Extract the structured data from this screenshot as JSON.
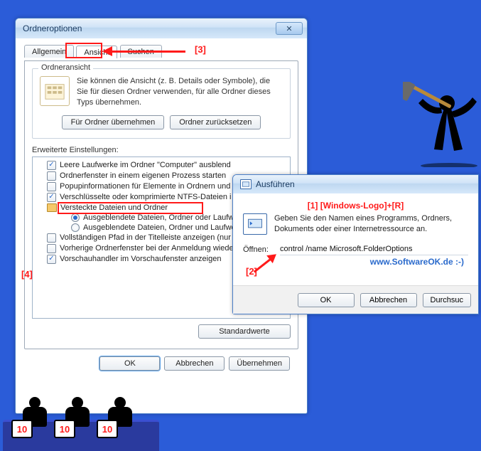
{
  "annotations": {
    "m1": "[1] [Windows-Logo]+[R]",
    "m2": "[2]",
    "m3": "[3]",
    "m4": "[4]"
  },
  "dialog": {
    "title": "Ordneroptionen",
    "tabs": [
      "Allgemein",
      "Ansicht",
      "Suchen"
    ],
    "group": {
      "legend": "Ordneransicht",
      "text": "Sie können die Ansicht (z. B. Details oder Symbole), die Sie für diesen Ordner verwenden, für alle Ordner dieses Typs übernehmen.",
      "btn_apply": "Für Ordner übernehmen",
      "btn_reset": "Ordner zurücksetzen"
    },
    "adv_label": "Erweiterte Einstellungen:",
    "tree": [
      {
        "type": "chk",
        "checked": true,
        "label": "Leere Laufwerke im Ordner \"Computer\" ausblend"
      },
      {
        "type": "chk",
        "checked": false,
        "label": "Ordnerfenster in einem eigenen Prozess starten"
      },
      {
        "type": "chk",
        "checked": false,
        "label": "Popupinformationen für Elemente in Ordnern und "
      },
      {
        "type": "chk",
        "checked": true,
        "label": "Verschlüsselte oder komprimierte NTFS-Dateien i"
      },
      {
        "type": "folder",
        "label": "Versteckte Dateien und Ordner",
        "highlight": true
      },
      {
        "type": "radio",
        "checked": true,
        "nested": true,
        "label": "Ausgeblendete Dateien, Ordner oder Laufwe"
      },
      {
        "type": "radio",
        "checked": false,
        "nested": true,
        "label": "Ausgeblendete Dateien, Ordner und Laufwe"
      },
      {
        "type": "chk",
        "checked": false,
        "label": "Vollständigen Pfad in der Titelleiste anzeigen (nur "
      },
      {
        "type": "chk",
        "checked": false,
        "label": "Vorherige Ordnerfenster bei der Anmeldung wiede"
      },
      {
        "type": "chk",
        "checked": true,
        "label": "Vorschauhandler im Vorschaufenster anzeigen"
      }
    ],
    "defaults_btn": "Standardwerte",
    "footer": {
      "ok": "OK",
      "cancel": "Abbrechen",
      "apply": "Übernehmen"
    }
  },
  "run": {
    "title": "Ausführen",
    "desc": "Geben Sie den Namen eines Programms, Ordners, Dokuments oder einer Internetressource an.",
    "open_label": "Öffnen:",
    "command": "control /name Microsoft.FolderOptions",
    "site": "www.SoftwareOK.de :-)",
    "footer": {
      "ok": "OK",
      "cancel": "Abbrechen",
      "browse": "Durchsuc"
    }
  },
  "scores": [
    "10",
    "10",
    "10"
  ]
}
